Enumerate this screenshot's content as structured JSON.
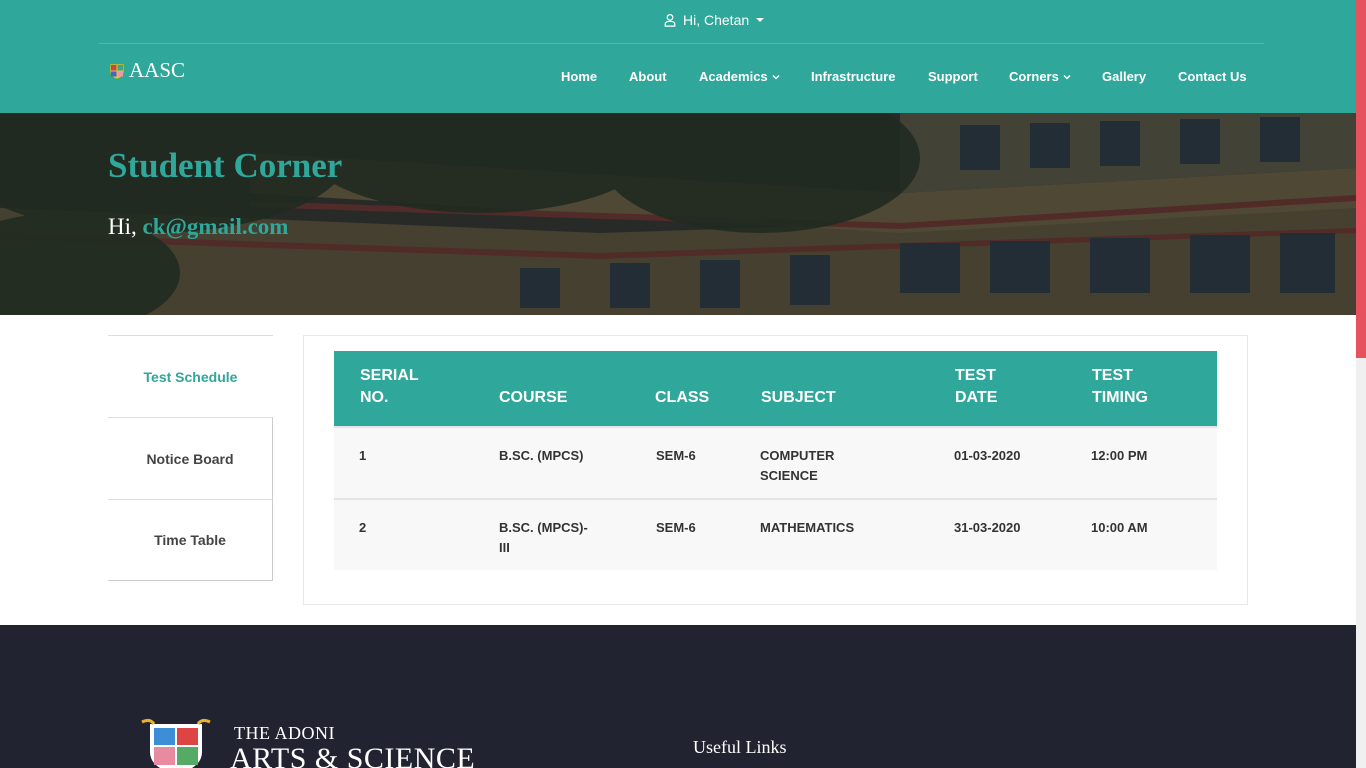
{
  "header": {
    "user_greeting": "Hi, Chetan",
    "brand": "AASC",
    "nav": [
      {
        "label": "Home",
        "has_dropdown": false
      },
      {
        "label": "About",
        "has_dropdown": false
      },
      {
        "label": "Academics",
        "has_dropdown": true
      },
      {
        "label": "Infrastructure",
        "has_dropdown": false
      },
      {
        "label": "Support",
        "has_dropdown": false
      },
      {
        "label": "Corners",
        "has_dropdown": true
      },
      {
        "label": "Gallery",
        "has_dropdown": false
      },
      {
        "label": "Contact Us",
        "has_dropdown": false
      }
    ]
  },
  "hero": {
    "title": "Student Corner",
    "greeting_prefix": "Hi,",
    "email": "ck@gmail.com"
  },
  "sidebar": {
    "tabs": [
      {
        "label": "Test Schedule",
        "active": true
      },
      {
        "label": "Notice Board",
        "active": false
      },
      {
        "label": "Time Table",
        "active": false
      }
    ]
  },
  "schedule": {
    "columns": {
      "serial": [
        "SERIAL",
        "NO."
      ],
      "course": "COURSE",
      "class": "CLASS",
      "subject": "SUBJECT",
      "date": [
        "TEST",
        "DATE"
      ],
      "timing": [
        "TEST",
        "TIMING"
      ]
    },
    "rows": [
      {
        "serial": "1",
        "course": [
          "B.SC. (MPCS)"
        ],
        "class": "SEM-6",
        "subject": [
          "COMPUTER",
          "SCIENCE"
        ],
        "date": "01-03-2020",
        "timing": "12:00 PM"
      },
      {
        "serial": "2",
        "course": [
          "B.SC. (MPCS)-",
          "III"
        ],
        "class": "SEM-6",
        "subject": [
          "MATHEMATICS"
        ],
        "date": "31-03-2020",
        "timing": "10:00 AM"
      }
    ]
  },
  "footer": {
    "logo_line1": "THE ADONI",
    "logo_line2": "ARTS & SCIENCE",
    "useful_links_heading": "Useful Links"
  },
  "colors": {
    "primary": "#2fa79b",
    "footer_bg": "#212330",
    "scroll_thumb": "#e6535e"
  }
}
